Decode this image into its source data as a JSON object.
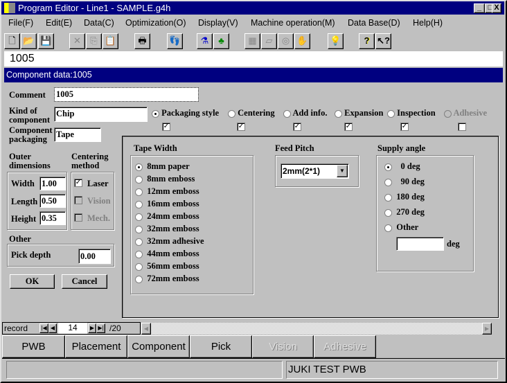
{
  "window": {
    "title": "Program Editor - Line1 - SAMPLE.g4h",
    "min": "_",
    "max": "□",
    "close": "X"
  },
  "menu": [
    "File(F)",
    "Edit(E)",
    "Data(C)",
    "Optimization(O)",
    "Display(V)",
    "Machine operation(M)",
    "Data Base(D)",
    "Help(H)"
  ],
  "toolbar": {
    "new": "🗋",
    "open": "📂",
    "save": "💾",
    "cut": "✕",
    "copy": "⎘",
    "paste": "📋",
    "print": "🖶",
    "find": "👣",
    "opt1": "⚗",
    "opt2": "♣",
    "d1": "▦",
    "d2": "▱",
    "d3": "◎",
    "d4": "✋",
    "light": "💡",
    "help": "?",
    "ctxhelp": "↖?"
  },
  "address_value": "1005",
  "dialog": {
    "title": "Component data:1005",
    "comment_label": "Comment",
    "comment_value": "1005",
    "kind_label": "Kind of component",
    "kind_value": "Chip",
    "packaging_label": "Component packaging",
    "packaging_value": "Tape",
    "tabs": [
      {
        "label": "Packaging style",
        "selected": true,
        "checked": true
      },
      {
        "label": "Centering",
        "checked": true
      },
      {
        "label": "Add info.",
        "checked": true
      },
      {
        "label": "Expansion",
        "checked": true
      },
      {
        "label": "Inspection",
        "checked": true
      },
      {
        "label": "Adhesive",
        "disabled": true,
        "checked": false
      }
    ],
    "outer_label": "Outer dimensions",
    "width_label": "Width",
    "width_value": "1.00",
    "length_label": "Length",
    "length_value": "0.50",
    "height_label": "Height",
    "height_value": "0.35",
    "centering_label": "Centering method",
    "laser": "Laser",
    "vision": "Vision",
    "mech": "Mech.",
    "other_label": "Other",
    "pick_depth_label": "Pick depth",
    "pick_depth_value": "0.00",
    "ok": "OK",
    "cancel": "Cancel",
    "tape_width_label": "Tape Width",
    "tape_widths": [
      "8mm paper",
      "8mm emboss",
      "12mm emboss",
      "16mm emboss",
      "24mm emboss",
      "32mm emboss",
      "32mm adhesive",
      "44mm emboss",
      "56mm emboss",
      "72mm emboss"
    ],
    "feed_pitch_label": "Feed Pitch",
    "feed_pitch_value": "2mm(2*1)",
    "supply_angle_label": "Supply angle",
    "supply_angles": [
      "0 deg",
      "90 deg",
      "180 deg",
      "270 deg",
      "Other"
    ],
    "other_deg_unit": "deg"
  },
  "record": {
    "label": "record",
    "current": "14",
    "total": "/20"
  },
  "bottom_tabs": [
    "PWB",
    "Placement",
    "Component",
    "Pick",
    "Vision",
    "Adhesive"
  ],
  "status": {
    "left": "",
    "right": "JUKI TEST PWB"
  }
}
